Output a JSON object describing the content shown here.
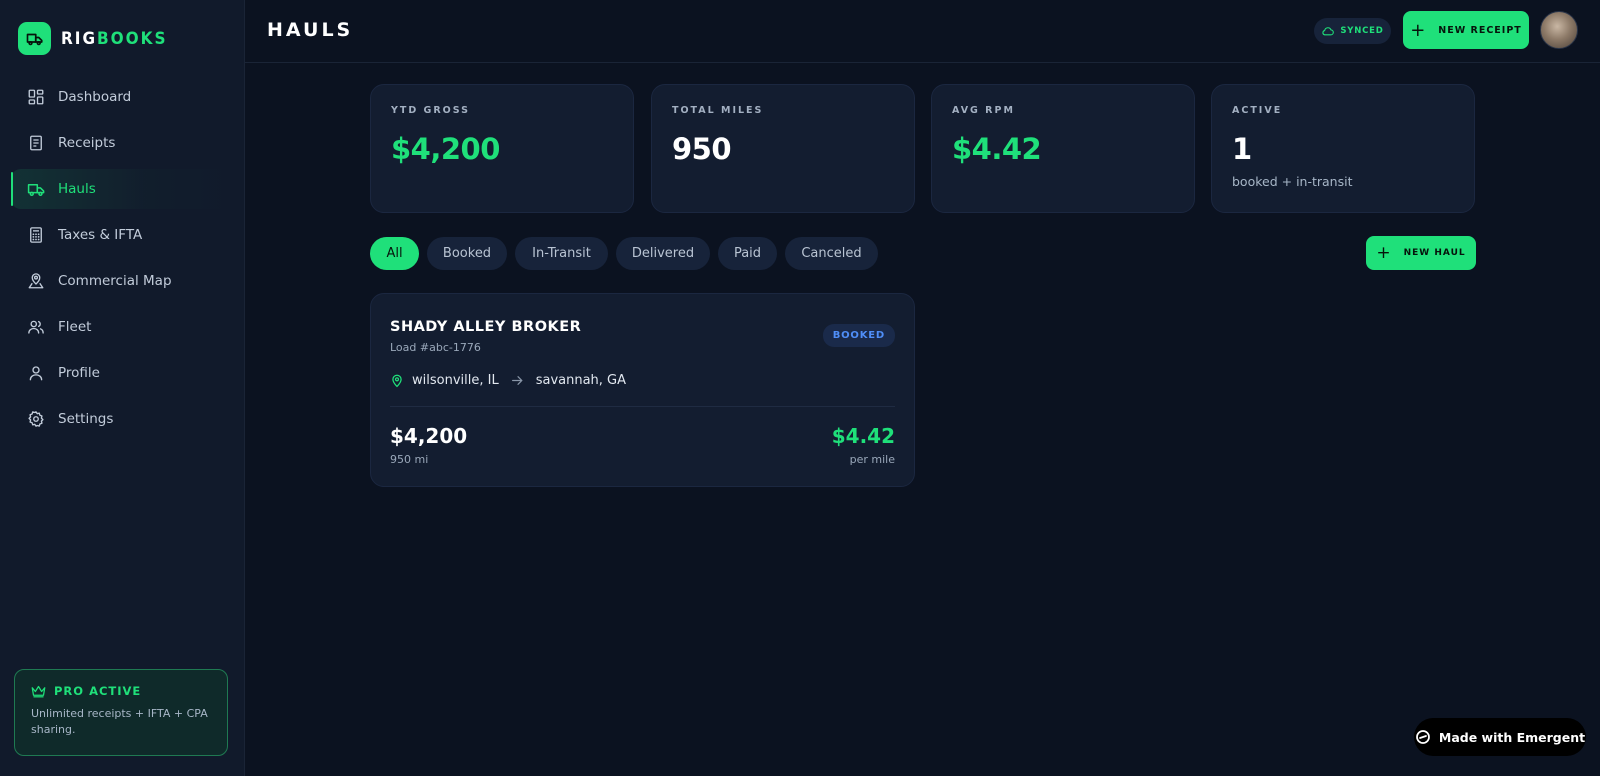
{
  "brand": {
    "part1": "RIG",
    "part2": "BOOKS"
  },
  "sidebar": {
    "items": [
      {
        "label": "Dashboard",
        "icon": "grid-icon"
      },
      {
        "label": "Receipts",
        "icon": "receipt-icon"
      },
      {
        "label": "Hauls",
        "icon": "truck-icon",
        "active": true
      },
      {
        "label": "Taxes & IFTA",
        "icon": "calculator-icon"
      },
      {
        "label": "Commercial Map",
        "icon": "map-pin-icon"
      },
      {
        "label": "Fleet",
        "icon": "users-icon"
      },
      {
        "label": "Profile",
        "icon": "user-icon"
      },
      {
        "label": "Settings",
        "icon": "gear-icon"
      }
    ],
    "pro": {
      "title": "PRO ACTIVE",
      "desc": "Unlimited receipts + IFTA + CPA sharing."
    }
  },
  "header": {
    "title": "HAULS",
    "synced": "SYNCED",
    "new_receipt": "NEW RECEIPT"
  },
  "stats": [
    {
      "label": "YTD GROSS",
      "value": "$4,200",
      "color": "green"
    },
    {
      "label": "TOTAL MILES",
      "value": "950",
      "color": "white"
    },
    {
      "label": "AVG RPM",
      "value": "$4.42",
      "color": "green"
    },
    {
      "label": "ACTIVE",
      "value": "1",
      "sub": "booked + in-transit",
      "color": "white"
    }
  ],
  "filters": [
    "All",
    "Booked",
    "In-Transit",
    "Delivered",
    "Paid",
    "Canceled"
  ],
  "active_filter": "All",
  "new_haul": "NEW HAUL",
  "hauls": [
    {
      "broker": "SHADY ALLEY BROKER",
      "load": "Load #abc-1776",
      "status": "BOOKED",
      "origin": "wilsonville, IL",
      "destination": "savannah, GA",
      "gross": "$4,200",
      "miles": "950 mi",
      "rpm": "$4.42",
      "rpm_label": "per mile"
    }
  ],
  "badge": "Made with Emergent",
  "colors": {
    "accent": "#1fe07a",
    "background": "#0b1220",
    "card": "#131d30",
    "badge_blue": "#4f8ef7"
  }
}
